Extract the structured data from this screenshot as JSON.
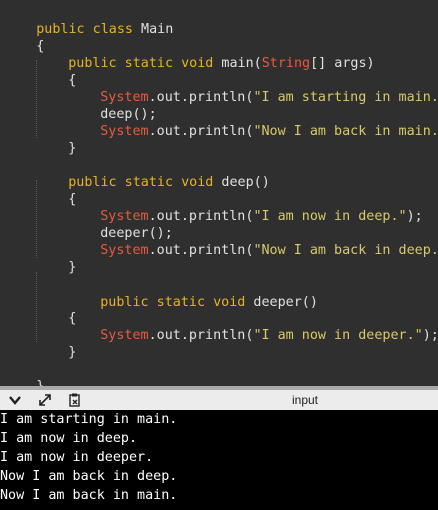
{
  "editor": {
    "lines": {
      "l1": {
        "a": "public class",
        "b": " Main"
      },
      "l2": {
        "a": "{"
      },
      "l3": {
        "a": "public static void",
        "b": " main(",
        "c": "String",
        "d": "[] args)"
      },
      "l4": {
        "a": "{"
      },
      "l5": {
        "a": "System",
        "b": ".out.println(",
        "c": "\"I am starting in main.\"",
        "d": ");"
      },
      "l6": {
        "a": "deep();"
      },
      "l7": {
        "a": "System",
        "b": ".out.println(",
        "c": "\"Now I am back in main.\"",
        "d": ");"
      },
      "l8": {
        "a": "}"
      },
      "l9": {
        "a": "public static void",
        "b": " deep()"
      },
      "l10": {
        "a": "{"
      },
      "l11": {
        "a": "System",
        "b": ".out.println(",
        "c": "\"I am now in deep.\"",
        "d": ");"
      },
      "l12": {
        "a": "deeper();"
      },
      "l13": {
        "a": "System",
        "b": ".out.println(",
        "c": "\"Now I am back in deep.\"",
        "d": ");"
      },
      "l14": {
        "a": "}"
      },
      "l15": {
        "a": "public static void",
        "b": " deeper()"
      },
      "l16": {
        "a": "{"
      },
      "l17": {
        "a": "System",
        "b": ".out.println(",
        "c": "\"I am now in deeper.\"",
        "d": ");"
      },
      "l18": {
        "a": "}"
      },
      "l19": {
        "a": "}"
      }
    }
  },
  "toolbar": {
    "icons": [
      "chevron-down-icon",
      "expand-icon",
      "clear-console-icon"
    ],
    "input_label": "input"
  },
  "console": {
    "lines": [
      "I am starting in main.",
      "I am now in deep.",
      "I am now in deeper.",
      "Now I am back in deep.",
      "Now I am back in main."
    ]
  },
  "colors": {
    "editor_bg": "#2f2f2f",
    "keyword": "#e6b422",
    "class": "#e45c3f",
    "string": "#d9c96a",
    "console_bg": "#000000",
    "console_text": "#ffffff"
  }
}
